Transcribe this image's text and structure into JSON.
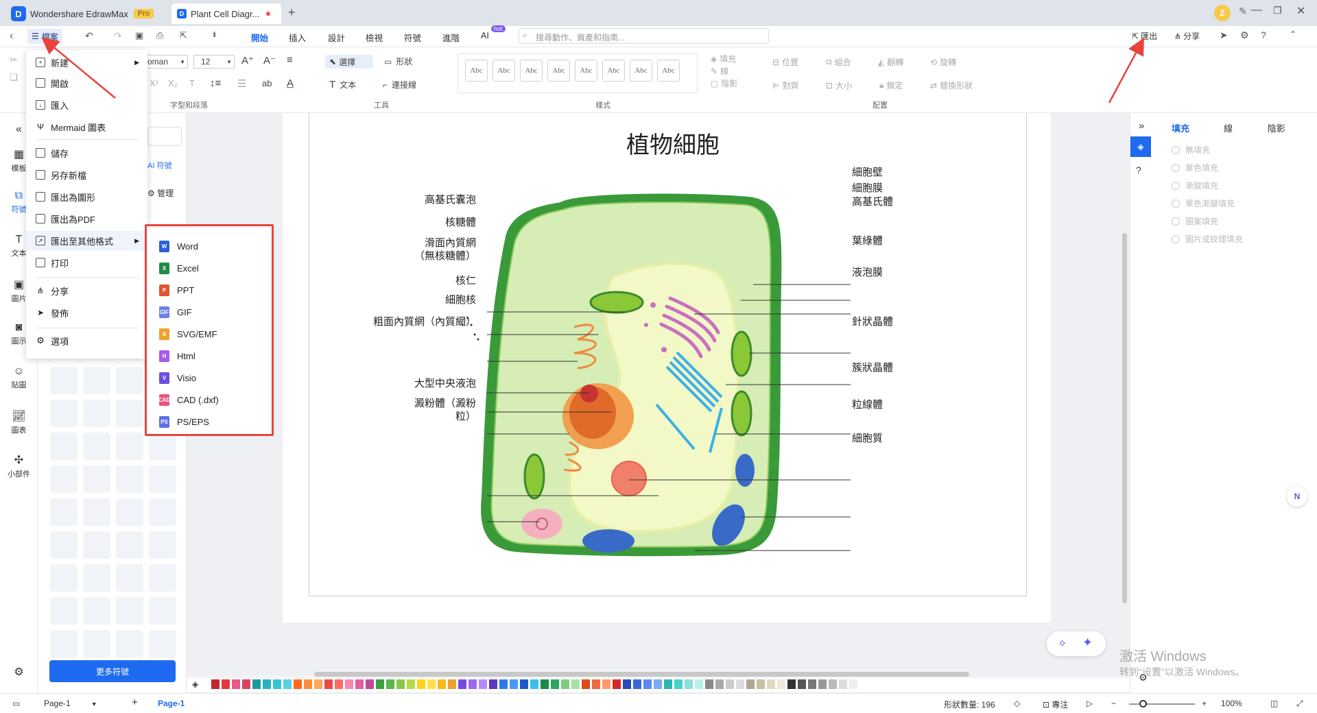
{
  "app": {
    "name": "Wondershare EdrawMax",
    "badge": "Pro",
    "doc_tab": "Plant Cell Diagr...",
    "window_buttons": [
      "minimize-icon",
      "restore-icon",
      "close-icon"
    ]
  },
  "menubar": {
    "file_label": "檔案",
    "tabs": [
      "開始",
      "插入",
      "設計",
      "檢視",
      "符號",
      "進階",
      "AI"
    ],
    "ai_badge": "hot",
    "search_placeholder": "搜尋動作、資產和指南...",
    "export_label": "匯出",
    "share_label": "分享"
  },
  "ribbon": {
    "font_name": "oman",
    "font_size": "12",
    "select_label": "選擇",
    "shape_label": "形狀",
    "text_label": "文本",
    "connector_label": "連接線",
    "fill_label": "填充",
    "line_label": "線",
    "shadow_label": "陰影",
    "position_label": "位置",
    "group_label": "組合",
    "flip_label": "翻轉",
    "rotate_label": "旋轉",
    "align_label": "對齊",
    "size_label": "大小",
    "lock_label": "鎖定",
    "replace_label": "替換形狀",
    "style_sample": "Abc",
    "groups": [
      "字型和段落",
      "工具",
      "樣式",
      "配置"
    ]
  },
  "leftrail": {
    "items": [
      "模板",
      "符號",
      "文本",
      "圖片",
      "圖示",
      "貼圖",
      "圖表",
      "小部件"
    ]
  },
  "library": {
    "ai_symbol": "AI 符號",
    "manage": "管理",
    "more_button": "更多符號"
  },
  "file_menu": {
    "items": [
      "新建",
      "開啟",
      "匯入",
      "Mermaid 圖表",
      "儲存",
      "另存新檔",
      "匯出為圖形",
      "匯出為PDF",
      "匯出至其他格式",
      "打印",
      "分享",
      "發佈",
      "選項"
    ]
  },
  "export_submenu": {
    "items": [
      {
        "label": "Word",
        "color": "#2b5fd9",
        "tag": "W"
      },
      {
        "label": "Excel",
        "color": "#1e8c47",
        "tag": "X"
      },
      {
        "label": "PPT",
        "color": "#e0552e",
        "tag": "P"
      },
      {
        "label": "GIF",
        "color": "#6a7ee8",
        "tag": "GIF"
      },
      {
        "label": "SVG/EMF",
        "color": "#f0a22e",
        "tag": "S"
      },
      {
        "label": "Html",
        "color": "#a65be8",
        "tag": "H"
      },
      {
        "label": "Visio",
        "color": "#6b4fe0",
        "tag": "V"
      },
      {
        "label": "CAD (.dxf)",
        "color": "#e8577a",
        "tag": "CAD"
      },
      {
        "label": "PS/EPS",
        "color": "#5b6fe8",
        "tag": "PS"
      }
    ]
  },
  "diagram": {
    "title": "植物細胞",
    "left_labels": [
      "高基氏囊泡",
      "核糖體",
      "滑面內質網",
      "（無核糖體）",
      "核仁",
      "細胞核",
      "粗面內質網（內質網）",
      "大型中央液泡",
      "澱粉體（澱粉",
      "粒）"
    ],
    "right_labels": [
      "細胞壁",
      "細胞膜",
      "高基氏體",
      "葉綠體",
      "液泡膜",
      "針狀晶體",
      "簇狀晶體",
      "粒線體",
      "細胞質"
    ]
  },
  "right_panel": {
    "tabs": [
      "填充",
      "線",
      "陰影"
    ],
    "options": [
      "無填充",
      "單色填充",
      "漸變填充",
      "單色漸變填充",
      "圖案填充",
      "圖片或紋理填充"
    ]
  },
  "status": {
    "page_select": "Page-1",
    "page_tab": "Page-1",
    "shape_count": "形狀數量: 196",
    "focus": "專注",
    "zoom": "100%"
  },
  "watermark": {
    "line1": "激活 Windows",
    "line2": "转到\"设置\"以激活 Windows。"
  },
  "palette": [
    "#c0262d",
    "#e03c3c",
    "#e85a8a",
    "#d9455f",
    "#1a9aa0",
    "#2bb3c0",
    "#36c6d3",
    "#5ad0e0",
    "#ff6a1a",
    "#ff8c3a",
    "#ffa85a",
    "#e84a4a",
    "#ff6a6a",
    "#f58ab0",
    "#e060a0",
    "#c04a9a",
    "#3ca040",
    "#5ab84a",
    "#8ac84a",
    "#b8d84a",
    "#ffd21a",
    "#ffe04a",
    "#ffb81a",
    "#f0a030",
    "#7a4ae0",
    "#9a6af0",
    "#b88af8",
    "#5a3ac0",
    "#2a7ae8",
    "#4a9af0",
    "#1a5ac8",
    "#3ac0e8",
    "#1a8a4a",
    "#2aa860",
    "#7ad07a",
    "#a8e0a8",
    "#e04a1a",
    "#f06a3a",
    "#ff9a6a",
    "#d02a2a",
    "#2a4ab8",
    "#3a6ad8",
    "#5a8af0",
    "#7aaaf8",
    "#2ab8b0",
    "#4ad0c8",
    "#8ae0d8",
    "#b8f0e8",
    "#888",
    "#aaa",
    "#ccc",
    "#ddd",
    "#b0a890",
    "#c8c0a8",
    "#e0d8c0",
    "#f0e8d8",
    "#333",
    "#555",
    "#777",
    "#999",
    "#bbb",
    "#ddd",
    "#eee"
  ]
}
